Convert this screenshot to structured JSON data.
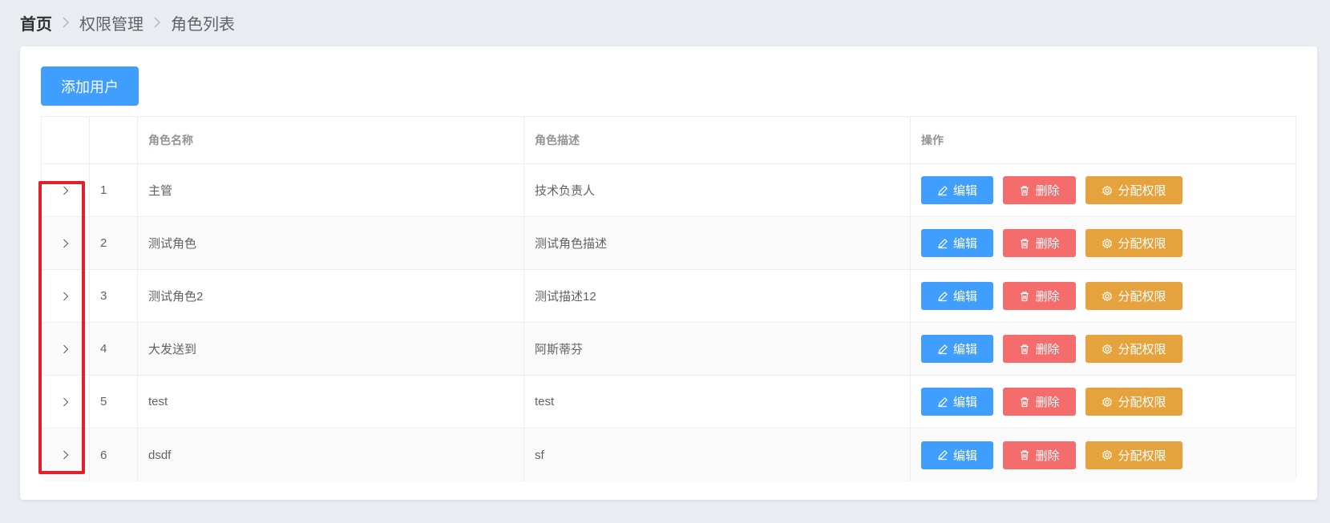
{
  "breadcrumb": [
    "首页",
    "权限管理",
    "角色列表"
  ],
  "toolbar": {
    "add_label": "添加用户"
  },
  "table": {
    "columns": [
      "",
      "",
      "角色名称",
      "角色描述",
      "操作"
    ],
    "rows": [
      {
        "index": "1",
        "name": "主管",
        "desc": "技术负责人"
      },
      {
        "index": "2",
        "name": "测试角色",
        "desc": "测试角色描述"
      },
      {
        "index": "3",
        "name": "测试角色2",
        "desc": "测试描述12"
      },
      {
        "index": "4",
        "name": "大发送到",
        "desc": "阿斯蒂芬"
      },
      {
        "index": "5",
        "name": "test",
        "desc": "test"
      },
      {
        "index": "6",
        "name": "dsdf",
        "desc": "sf"
      }
    ],
    "actions": {
      "edit": "编辑",
      "delete": "删除",
      "assign": "分配权限"
    }
  },
  "colors": {
    "primary": "#409eff",
    "danger": "#f56c6c",
    "warning": "#e6a23c",
    "highlight": "#e0202a"
  }
}
